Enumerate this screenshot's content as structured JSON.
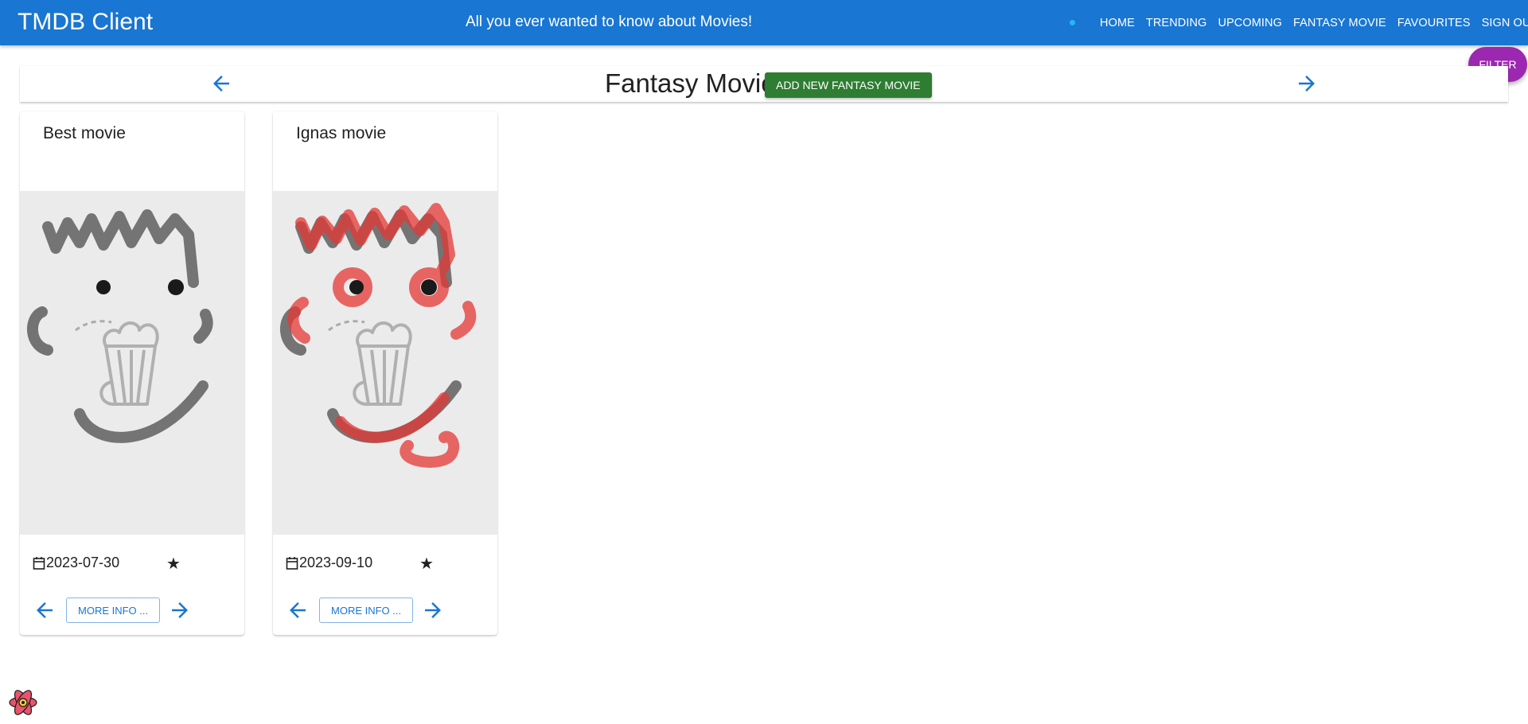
{
  "appbar": {
    "brand": "TMDB Client",
    "tagline": "All you ever wanted to know about Movies!",
    "nav": [
      "HOME",
      "TRENDING",
      "UPCOMING",
      "FANTASY MOVIE",
      "FAVOURITES",
      "SIGN OUT"
    ]
  },
  "filter_label": "FILTER",
  "header": {
    "title": "Fantasy Movie",
    "add_label": "ADD NEW FANTASY MOVIE"
  },
  "cards": [
    {
      "title": "Best movie",
      "date": "2023-07-30",
      "rating": "★",
      "more_label": "MORE INFO ..."
    },
    {
      "title": "Ignas movie",
      "date": "2023-09-10",
      "rating": "★",
      "more_label": "MORE INFO ..."
    }
  ],
  "colors": {
    "primary": "#1976d2",
    "success": "#2e7d32",
    "secondary": "#9c27b0",
    "scribble_red": "#e53935"
  },
  "icons": {
    "arrow_left": "arrow-back-icon",
    "arrow_right": "arrow-forward-icon",
    "calendar": "calendar-icon",
    "star": "star-icon",
    "devtools": "react-logo-icon"
  }
}
